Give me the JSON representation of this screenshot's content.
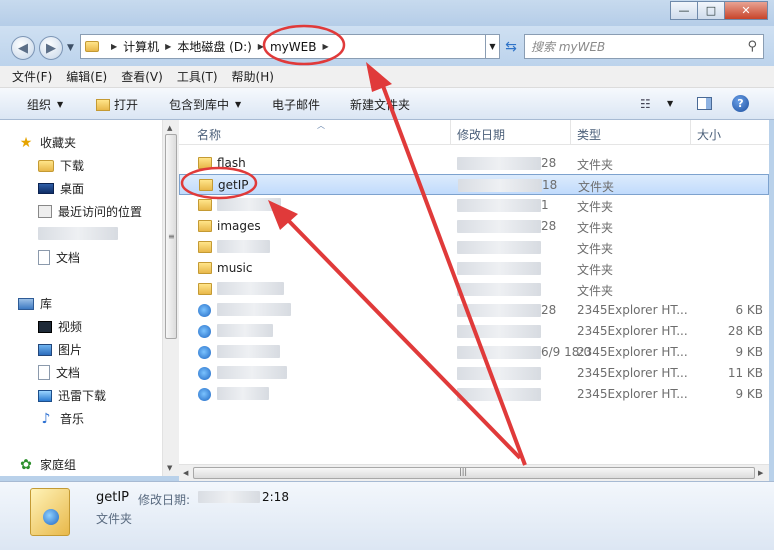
{
  "window": {
    "minimize": "—",
    "maximize": "□",
    "close": "✕"
  },
  "address": {
    "crumbs": [
      "计算机",
      "本地磁盘 (D:)",
      "myWEB"
    ],
    "search_placeholder": "搜索 myWEB"
  },
  "menu": [
    "文件(F)",
    "编辑(E)",
    "查看(V)",
    "工具(T)",
    "帮助(H)"
  ],
  "toolbar": {
    "organize": "组织",
    "open": "打开",
    "include_library": "包含到库中",
    "email": "电子邮件",
    "new_folder": "新建文件夹"
  },
  "nav": {
    "favorites": "收藏夹",
    "downloads": "下载",
    "desktop": "桌面",
    "recent": "最近访问的位置",
    "docs": "文档",
    "libraries": "库",
    "videos": "视频",
    "pictures": "图片",
    "lib_docs": "文档",
    "thunder": "迅雷下载",
    "music": "音乐",
    "homegroup": "家庭组"
  },
  "columns": {
    "name": "名称",
    "date": "修改日期",
    "type": "类型",
    "size": "大小"
  },
  "files": [
    {
      "name": "flash",
      "date": "28",
      "type": "文件夹",
      "size": "",
      "icon": "folder",
      "selected": false
    },
    {
      "name": "getIP",
      "date": "18",
      "type": "文件夹",
      "size": "",
      "icon": "folder",
      "selected": true
    },
    {
      "name": "",
      "date": "1",
      "type": "文件夹",
      "size": "",
      "icon": "folder",
      "selected": false
    },
    {
      "name": "images",
      "date": "28",
      "type": "文件夹",
      "size": "",
      "icon": "folder",
      "selected": false
    },
    {
      "name": "",
      "date": "",
      "type": "文件夹",
      "size": "",
      "icon": "folder",
      "selected": false
    },
    {
      "name": "music",
      "date": "",
      "type": "文件夹",
      "size": "",
      "icon": "folder",
      "selected": false
    },
    {
      "name": "",
      "date": "",
      "type": "文件夹",
      "size": "",
      "icon": "folder",
      "selected": false
    },
    {
      "name": "",
      "date": "28",
      "type": "2345Explorer HT...",
      "size": "6 KB",
      "icon": "html",
      "selected": false
    },
    {
      "name": "",
      "date": "",
      "type": "2345Explorer HT...",
      "size": "28 KB",
      "icon": "html",
      "selected": false
    },
    {
      "name": "",
      "date": "6/9 18:0",
      "type": "2345Explorer HT...",
      "size": "9 KB",
      "icon": "html",
      "selected": false
    },
    {
      "name": "",
      "date": "",
      "type": "2345Explorer HT...",
      "size": "11 KB",
      "icon": "html",
      "selected": false
    },
    {
      "name": "",
      "date": "",
      "type": "2345Explorer HT...",
      "size": "9 KB",
      "icon": "html",
      "selected": false
    }
  ],
  "details": {
    "name": "getIP",
    "date_label": "修改日期:",
    "date_value": "2:18",
    "type": "文件夹"
  }
}
